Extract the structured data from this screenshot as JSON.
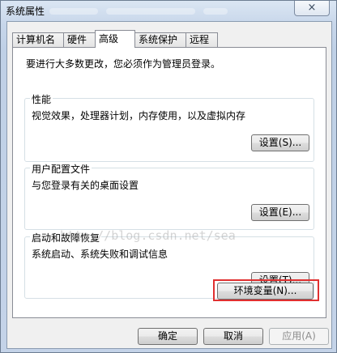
{
  "window": {
    "title": "系统属性",
    "close_icon": "×"
  },
  "tabs": [
    {
      "label": "计算机名",
      "active": false
    },
    {
      "label": "硬件",
      "active": false
    },
    {
      "label": "高级",
      "active": true
    },
    {
      "label": "系统保护",
      "active": false
    },
    {
      "label": "远程",
      "active": false
    }
  ],
  "page": {
    "intro": "要进行大多数更改，您必须作为管理员登录。",
    "performance": {
      "title": "性能",
      "desc": "视觉效果，处理器计划，内存使用，以及虚拟内存",
      "button": "设置(S)..."
    },
    "profiles": {
      "title": "用户配置文件",
      "desc": "与您登录有关的桌面设置",
      "button": "设置(E)..."
    },
    "startup": {
      "title": "启动和故障恢复",
      "desc": "系统启动、系统失败和调试信息",
      "button": "设置(T)..."
    },
    "env_button": "环境变量(N)...",
    "watermark": "http://blog.csdn.net/sea"
  },
  "footer": {
    "ok": "确定",
    "cancel": "取消",
    "apply": "应用(A)"
  },
  "colors": {
    "highlight_border": "#e03030",
    "window_frame": "#c4d3e8"
  }
}
